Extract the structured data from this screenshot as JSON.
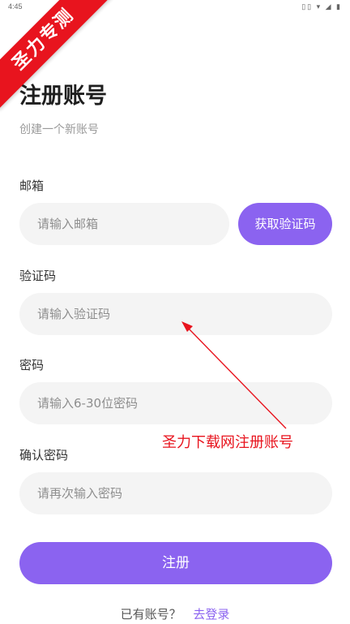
{
  "status_bar": {
    "time": "4:45",
    "icons_text": "▯▯ ▾ ◢ ▮"
  },
  "watermark": {
    "text": "圣力专测",
    "color": "#e8141e"
  },
  "header": {
    "title": "注册账号",
    "subtitle": "创建一个新账号"
  },
  "form": {
    "email": {
      "label": "邮箱",
      "placeholder": "请输入邮箱",
      "value": ""
    },
    "get_code_button": "获取验证码",
    "code": {
      "label": "验证码",
      "placeholder": "请输入验证码",
      "value": ""
    },
    "password": {
      "label": "密码",
      "placeholder": "请输入6-30位密码",
      "value": ""
    },
    "confirm_password": {
      "label": "确认密码",
      "placeholder": "请再次输入密码",
      "value": ""
    },
    "register_button": "注册"
  },
  "footer": {
    "prompt": "已有账号？",
    "login_link": "去登录"
  },
  "annotation": {
    "text": "圣力下载网注册账号",
    "color": "#e8141e"
  },
  "colors": {
    "accent": "#8b63f0",
    "input_bg": "#f4f4f4"
  }
}
